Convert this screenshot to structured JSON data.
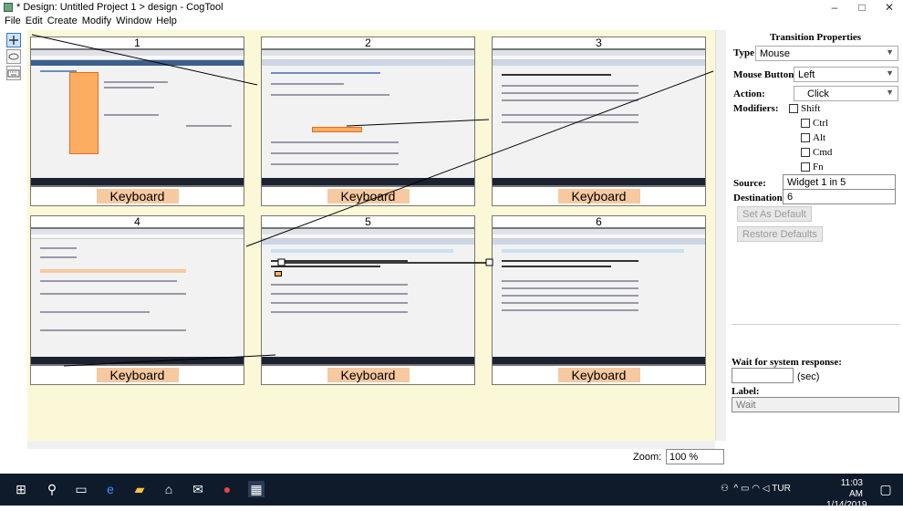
{
  "window": {
    "title": "* Design: Untitled Project 1 > design - CogTool",
    "minimize": "–",
    "maximize": "□",
    "close": "✕"
  },
  "menu": [
    "File",
    "Edit",
    "Create",
    "Modify",
    "Window",
    "Help"
  ],
  "frames": [
    {
      "number": "1",
      "widget_label": "Keyboard"
    },
    {
      "number": "2",
      "widget_label": "Keyboard"
    },
    {
      "number": "3",
      "widget_label": "Keyboard"
    },
    {
      "number": "4",
      "widget_label": "Keyboard"
    },
    {
      "number": "5",
      "widget_label": "Keyboard"
    },
    {
      "number": "6",
      "widget_label": "Keyboard"
    }
  ],
  "zoom": {
    "label": "Zoom:",
    "value": "100 %"
  },
  "props": {
    "title": "Transition Properties",
    "type_label": "Type:",
    "type_value": "Mouse",
    "button_label": "Mouse Button:",
    "button_value": "Left",
    "action_label": "Action:",
    "action_value": "Click",
    "modifiers_label": "Modifiers:",
    "modifiers": [
      "Shift",
      "Ctrl",
      "Alt",
      "Cmd",
      "Fn"
    ],
    "source_label": "Source:",
    "source_value": "Widget 1 in 5",
    "dest_label": "Destination:",
    "dest_value": "6",
    "set_default": "Set As Default",
    "restore_defaults": "Restore Defaults",
    "wait_label": "Wait for system response:",
    "wait_unit": "(sec)",
    "label_label": "Label:",
    "label_value": "Wait"
  },
  "taskbar": {
    "time": "11:03 AM",
    "date": "1/14/2019",
    "lang": "TUR"
  }
}
